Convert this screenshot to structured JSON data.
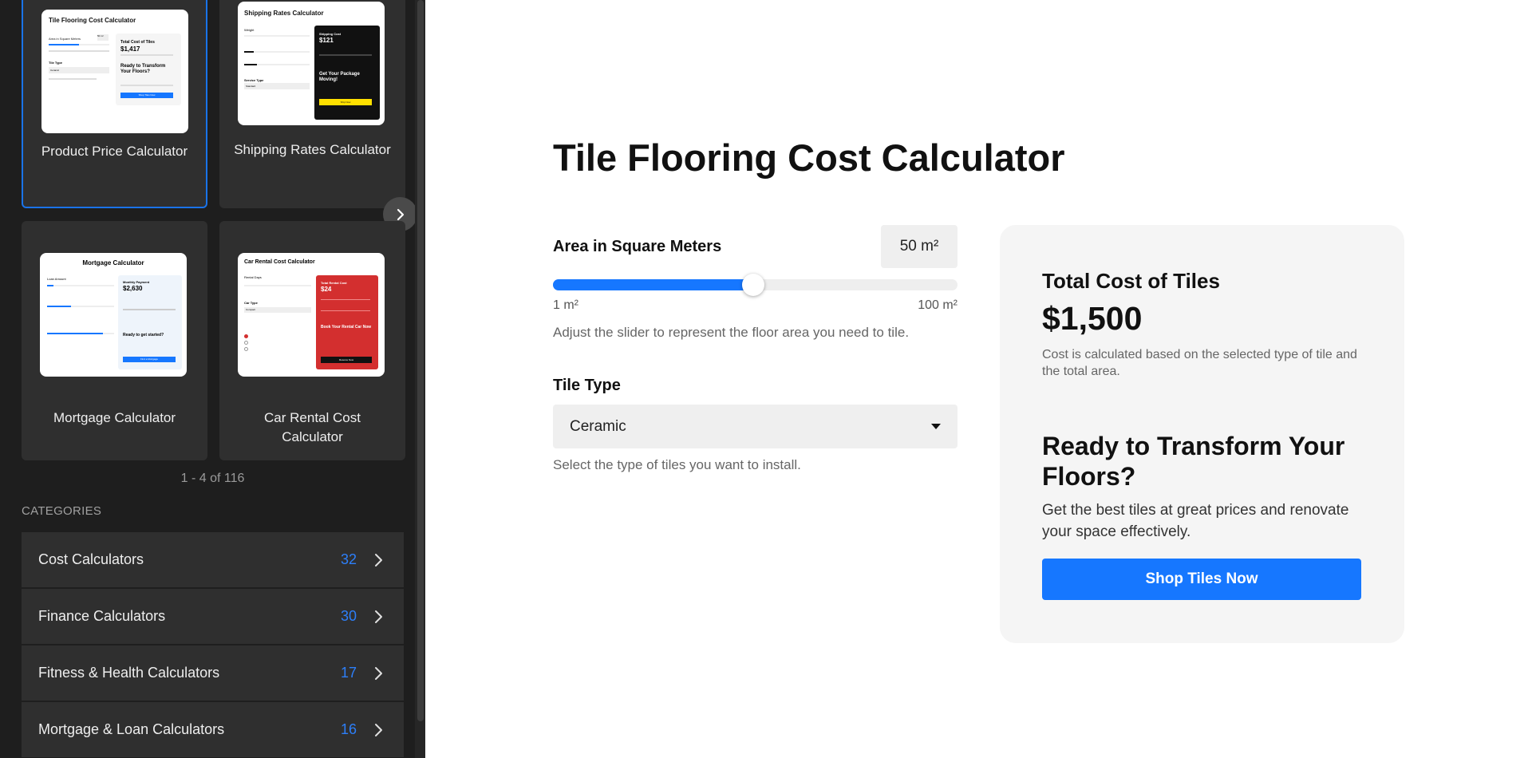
{
  "sidebar": {
    "cards": [
      {
        "title": "Product Price Calculator",
        "selected": true,
        "thumb": {
          "heading": "Tile Flooring Cost Calculator",
          "field": "Area in Square Meters",
          "field_value": "50 m²",
          "select_label": "Tile Type",
          "select_value": "Ceramic",
          "total_label": "Total Cost of Tiles",
          "total_value": "$1,417",
          "cta_heading": "Ready to Transform Your Floors?",
          "button": "Shop Tiles Now"
        }
      },
      {
        "title": "Shipping Rates Calculator",
        "selected": false,
        "thumb": {
          "heading": "Shipping Rates Calculator",
          "field": "Weight",
          "select_label": "Service Type",
          "select_value": "Standard",
          "total_label": "Shipping Cost",
          "total_value": "$121",
          "cta_heading": "Get Your Package Moving!",
          "button": "Ship Now"
        }
      },
      {
        "title": "Mortgage Calculator",
        "selected": false,
        "thumb": {
          "heading": "Mortgage Calculator",
          "field": "Loan Amount",
          "total_label": "Monthly Payment",
          "total_value": "$2,630",
          "cta_heading": "Ready to get started?",
          "button": "Find a Mortgage"
        }
      },
      {
        "title": "Car Rental Cost Calculator",
        "selected": false,
        "thumb": {
          "heading": "Car Rental Cost Calculator",
          "field": "Rental Days",
          "select_label": "Car Type",
          "select_value": "Compact",
          "total_label": "Total Rental Cost",
          "total_value": "$24",
          "cta_heading": "Book Your Rental Car Now",
          "button": "Reserve Now"
        }
      }
    ],
    "pager": "1 - 4 of 116",
    "categories_heading": "CATEGORIES",
    "categories": [
      {
        "label": "Cost Calculators",
        "count": "32"
      },
      {
        "label": "Finance Calculators",
        "count": "30"
      },
      {
        "label": "Fitness & Health Calculators",
        "count": "17"
      },
      {
        "label": "Mortgage & Loan Calculators",
        "count": "16"
      }
    ]
  },
  "calculator": {
    "title": "Tile Flooring Cost Calculator",
    "area": {
      "label": "Area in Square Meters",
      "value_display": "50 m²",
      "value": 50,
      "min": 1,
      "max": 100,
      "min_label": "1 m²",
      "max_label": "100 m²",
      "help": "Adjust the slider to represent the floor area you need to tile."
    },
    "tile_type": {
      "label": "Tile Type",
      "selected": "Ceramic",
      "help": "Select the type of tiles you want to install."
    },
    "result": {
      "heading": "Total Cost of Tiles",
      "amount": "$1,500",
      "note": "Cost is calculated based on the selected type of tile and the total area."
    },
    "cta": {
      "heading": "Ready to Transform Your Floors?",
      "text": "Get the best tiles at great prices and renovate your space effectively.",
      "button": "Shop Tiles Now"
    }
  },
  "colors": {
    "accent": "#1677ff",
    "sidebar_bg": "#1e1e1e",
    "card_bg": "#2f2f2f",
    "count": "#2d7ff9"
  }
}
